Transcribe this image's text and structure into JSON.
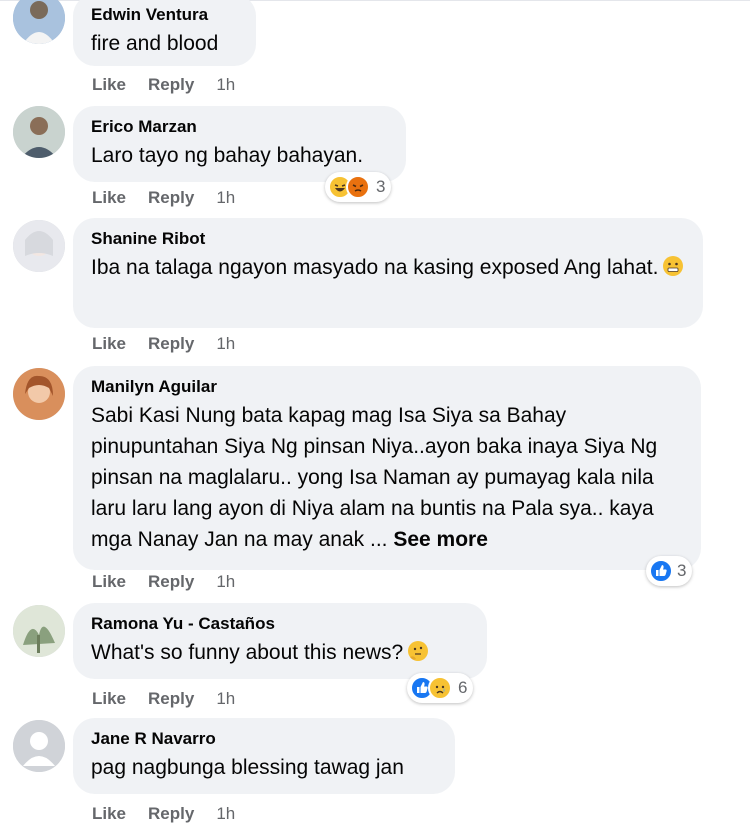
{
  "comments": [
    {
      "name": "Edwin Ventura",
      "text": "fire and blood",
      "like": "Like",
      "reply": "Reply",
      "time": "1h"
    },
    {
      "name": "Erico Marzan",
      "text": "Laro tayo ng bahay bahayan.",
      "like": "Like",
      "reply": "Reply",
      "time": "1h",
      "reaction_count": "3",
      "reaction_icons": [
        "haha-icon",
        "angry-icon"
      ]
    },
    {
      "name": "Shanine Ribot",
      "text": "Iba na talaga ngayon masyado na kasing exposed Ang lahat.",
      "like": "Like",
      "reply": "Reply",
      "time": "1h"
    },
    {
      "name": "Manilyn Aguilar",
      "text": "Sabi Kasi Nung bata kapag mag Isa Siya sa Bahay pinupuntahan Siya Ng pinsan Niya..ayon baka inaya Siya Ng pinsan na maglalaru.. yong Isa Naman ay pumayag kala nila laru laru lang ayon di Niya alam na buntis na Pala sya.. kaya mga Nanay Jan na may anak ...",
      "see_more": "See more",
      "like": "Like",
      "reply": "Reply",
      "time": "1h",
      "reaction_count": "3",
      "reaction_icons": [
        "like-icon"
      ]
    },
    {
      "name": "Ramona Yu - Castaños",
      "text": "What's so funny about this news?",
      "like": "Like",
      "reply": "Reply",
      "time": "1h",
      "reaction_count": "6",
      "reaction_icons": [
        "like-icon",
        "sad-icon"
      ]
    },
    {
      "name": "Jane R Navarro",
      "text": "pag nagbunga blessing tawag jan",
      "like": "Like",
      "reply": "Reply",
      "time": "1h"
    }
  ],
  "colors": {
    "bubble": "#f0f2f5",
    "meta": "#65676b",
    "like_blue": "#1877f2",
    "emoji_yellow": "#f7c233",
    "angry_orange": "#e9710f"
  }
}
